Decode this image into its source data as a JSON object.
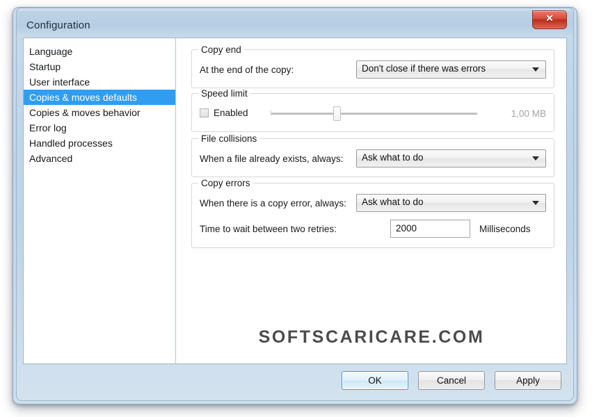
{
  "window": {
    "title": "Configuration",
    "close_label": "✕"
  },
  "sidebar": {
    "items": [
      {
        "label": "Language",
        "selected": false
      },
      {
        "label": "Startup",
        "selected": false
      },
      {
        "label": "User interface",
        "selected": false
      },
      {
        "label": "Copies & moves defaults",
        "selected": true
      },
      {
        "label": "Copies & moves behavior",
        "selected": false
      },
      {
        "label": "Error log",
        "selected": false
      },
      {
        "label": "Handled processes",
        "selected": false
      },
      {
        "label": "Advanced",
        "selected": false
      }
    ]
  },
  "groups": {
    "copy_end": {
      "legend": "Copy end",
      "label": "At the end of the copy:",
      "dropdown_value": "Don't close if there was errors"
    },
    "speed_limit": {
      "legend": "Speed limit",
      "checkbox_label": "Enabled",
      "checkbox_checked": false,
      "slider_percent": 32,
      "value": "1,00 MB"
    },
    "file_collisions": {
      "legend": "File collisions",
      "label": "When a file already exists, always:",
      "dropdown_value": "Ask what to do"
    },
    "copy_errors": {
      "legend": "Copy errors",
      "label": "When there is a copy error, always:",
      "dropdown_value": "Ask what to do",
      "retry_label": "Time to wait between two retries:",
      "retry_value": "2000",
      "retry_units": "Milliseconds"
    }
  },
  "watermark": "SOFTSCARICARE.COM",
  "footer": {
    "ok": "OK",
    "cancel": "Cancel",
    "apply": "Apply"
  },
  "colors": {
    "selection": "#2f9ef2",
    "titlebar": "#b6cde3",
    "close_button": "#d94e3a"
  }
}
